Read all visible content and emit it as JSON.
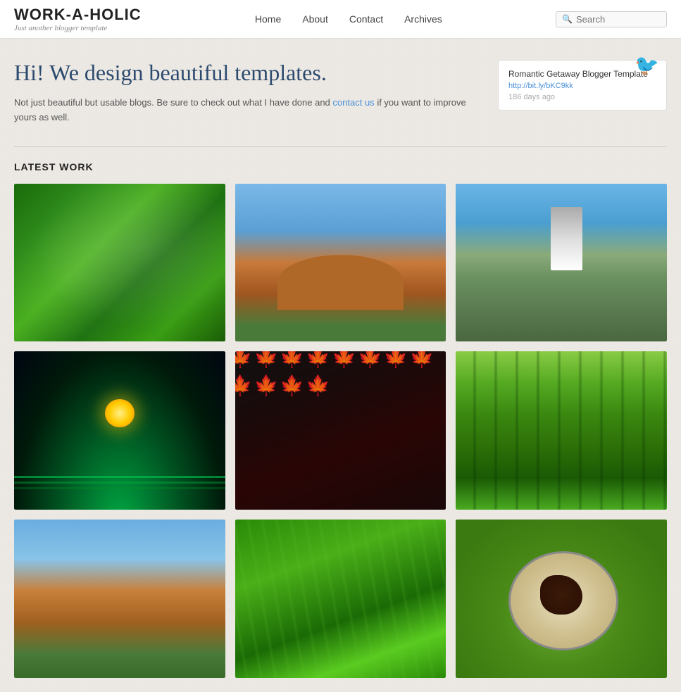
{
  "header": {
    "site_title": "WORK-A-HOLIC",
    "site_tagline": "Just another blogger template",
    "nav": {
      "home": "Home",
      "about": "About",
      "contact": "Contact",
      "archives": "Archives"
    },
    "search_placeholder": "Search"
  },
  "hero": {
    "heading": "Hi! We design beautiful templates.",
    "body_text": "Not just beautiful but usable blogs. Be sure to check out what I have done and",
    "link_text": "contact us",
    "body_text2": " if you want to improve yours as well."
  },
  "twitter_widget": {
    "title": "Romantic Getaway Blogger Template",
    "link": "http://bit.ly/bKC9kk",
    "time": "186 days ago"
  },
  "latest_work": {
    "heading": "LATEST WORK",
    "images": [
      {
        "id": 1,
        "alt": "Green leaves close-up",
        "class": "img-green-leaves"
      },
      {
        "id": 2,
        "alt": "Rock arch by the sea",
        "class": "img-rock-arch"
      },
      {
        "id": 3,
        "alt": "Mountain with waterfall",
        "class": "img-mountain-waterfall"
      },
      {
        "id": 4,
        "alt": "Planet from space",
        "class": "img-planet"
      },
      {
        "id": 5,
        "alt": "Red maple leaves",
        "class": "img-red-maple"
      },
      {
        "id": 6,
        "alt": "Green forest",
        "class": "img-green-forest"
      },
      {
        "id": 7,
        "alt": "Rock arch landscape",
        "class": "img-rock-arch2"
      },
      {
        "id": 8,
        "alt": "Green grass close-up",
        "class": "img-grass-closeup"
      },
      {
        "id": 9,
        "alt": "Food on green plate",
        "class": "img-food"
      }
    ]
  }
}
